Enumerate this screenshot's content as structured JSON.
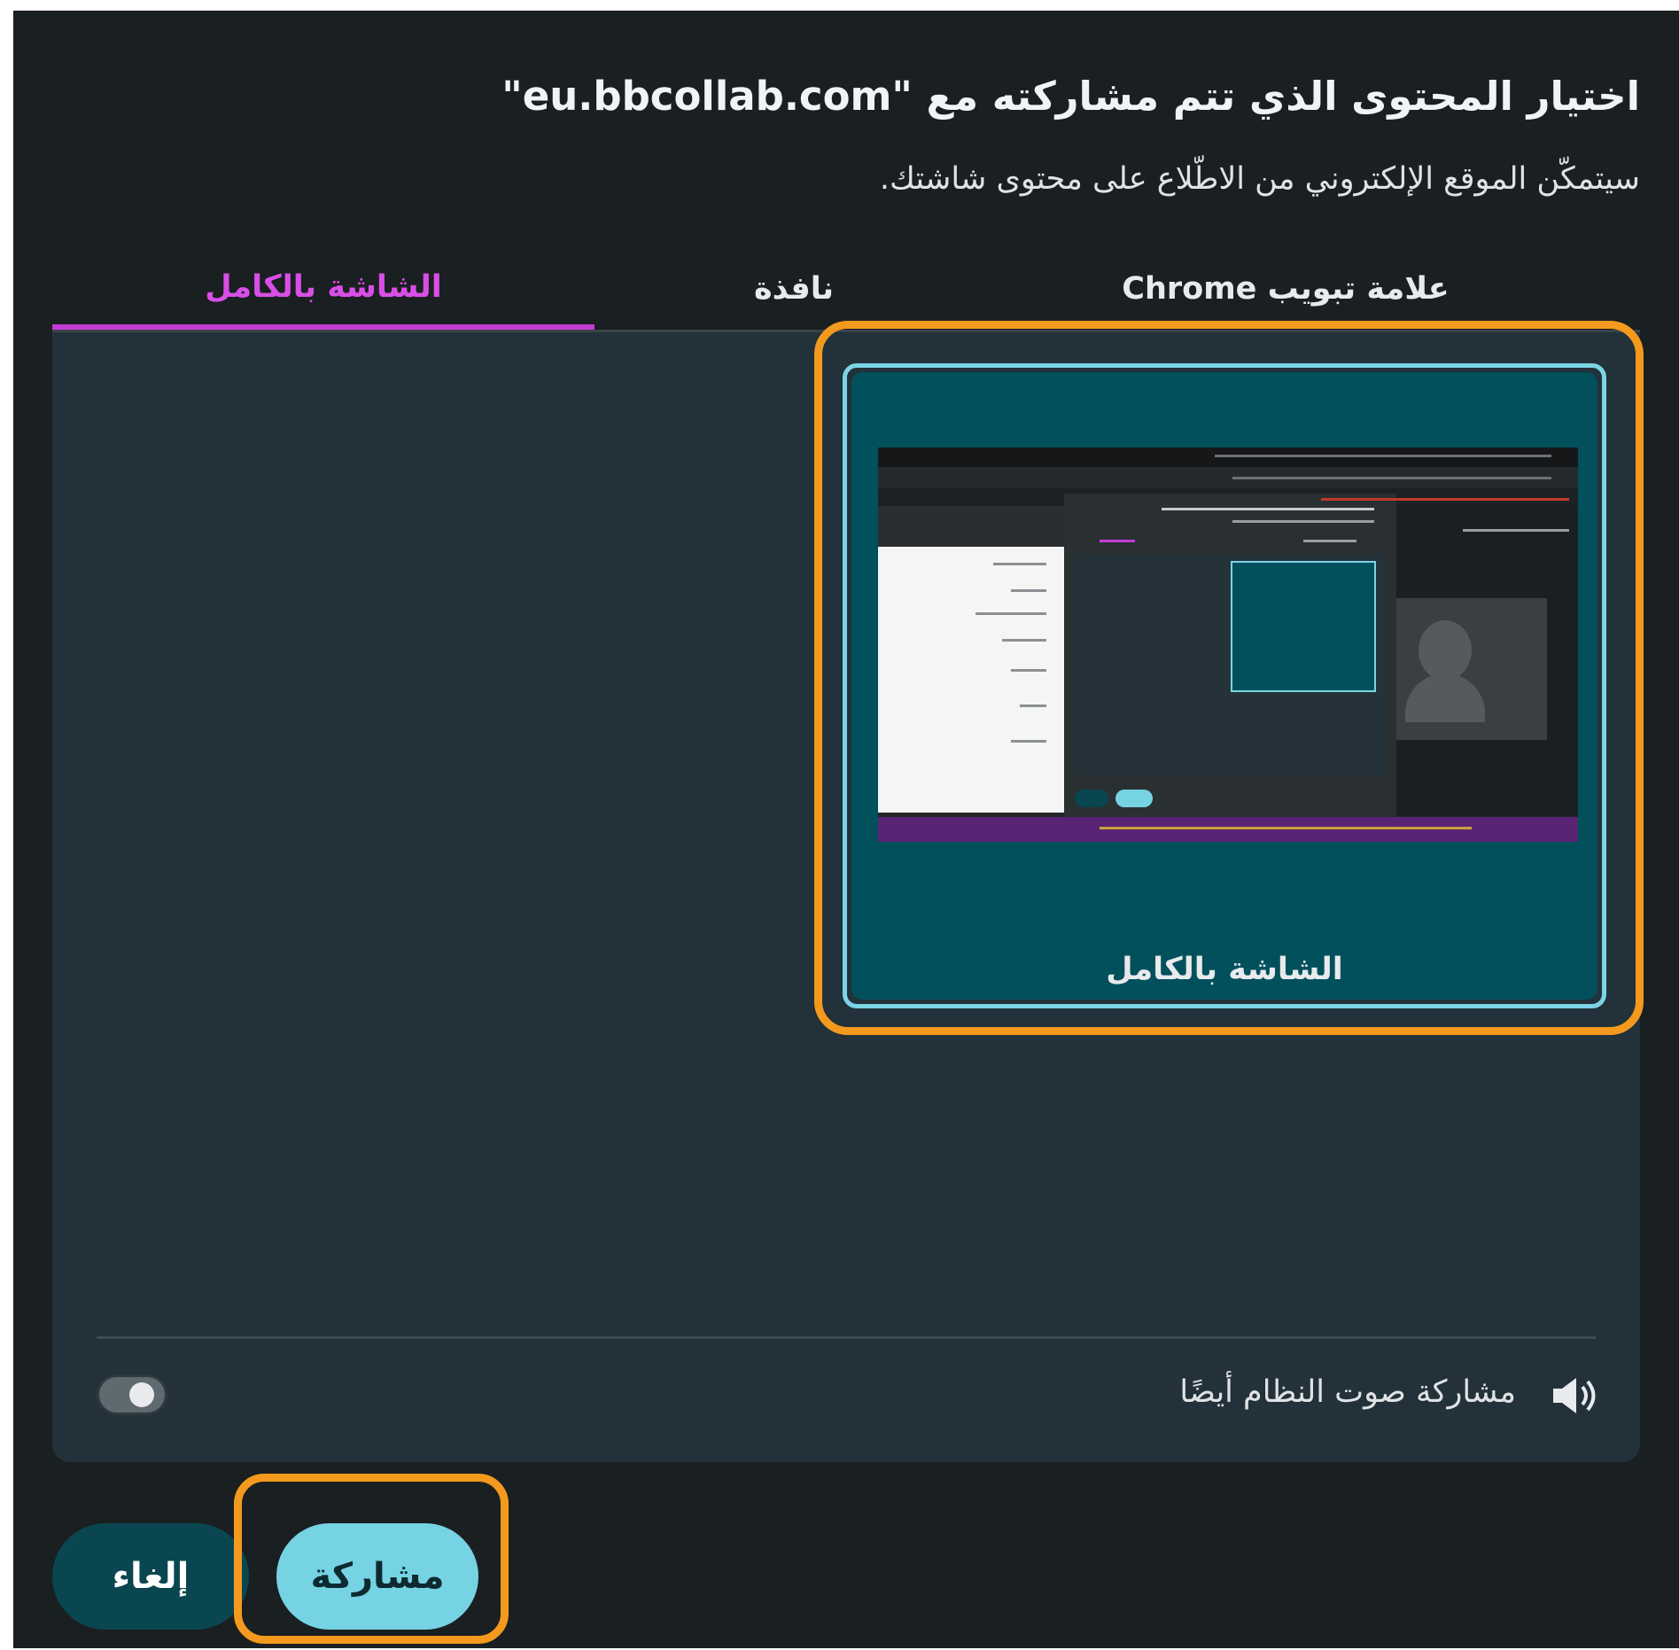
{
  "dialog": {
    "title": "اختيار المحتوى الذي تتم مشاركته مع \"eu.bbcollab.com\"",
    "subtitle": "سيتمكّن الموقع الإلكتروني من الاطّلاع على محتوى شاشتك."
  },
  "tabs": [
    {
      "label": "علامة تبويب Chrome",
      "active": false
    },
    {
      "label": "نافذة",
      "active": false
    },
    {
      "label": "الشاشة بالكامل",
      "active": true
    }
  ],
  "screen_card": {
    "label": "الشاشة بالكامل",
    "selected": true
  },
  "audio": {
    "label": "مشاركة صوت النظام أيضًا",
    "enabled": false,
    "icon": "speaker-icon"
  },
  "buttons": {
    "share": "مشاركة",
    "cancel": "إلغاء"
  },
  "colors": {
    "accent_tab": "#c43cd6",
    "highlight": "#f39a1e",
    "card_border": "#7cd4e6",
    "share_button": "#76d3e4"
  }
}
